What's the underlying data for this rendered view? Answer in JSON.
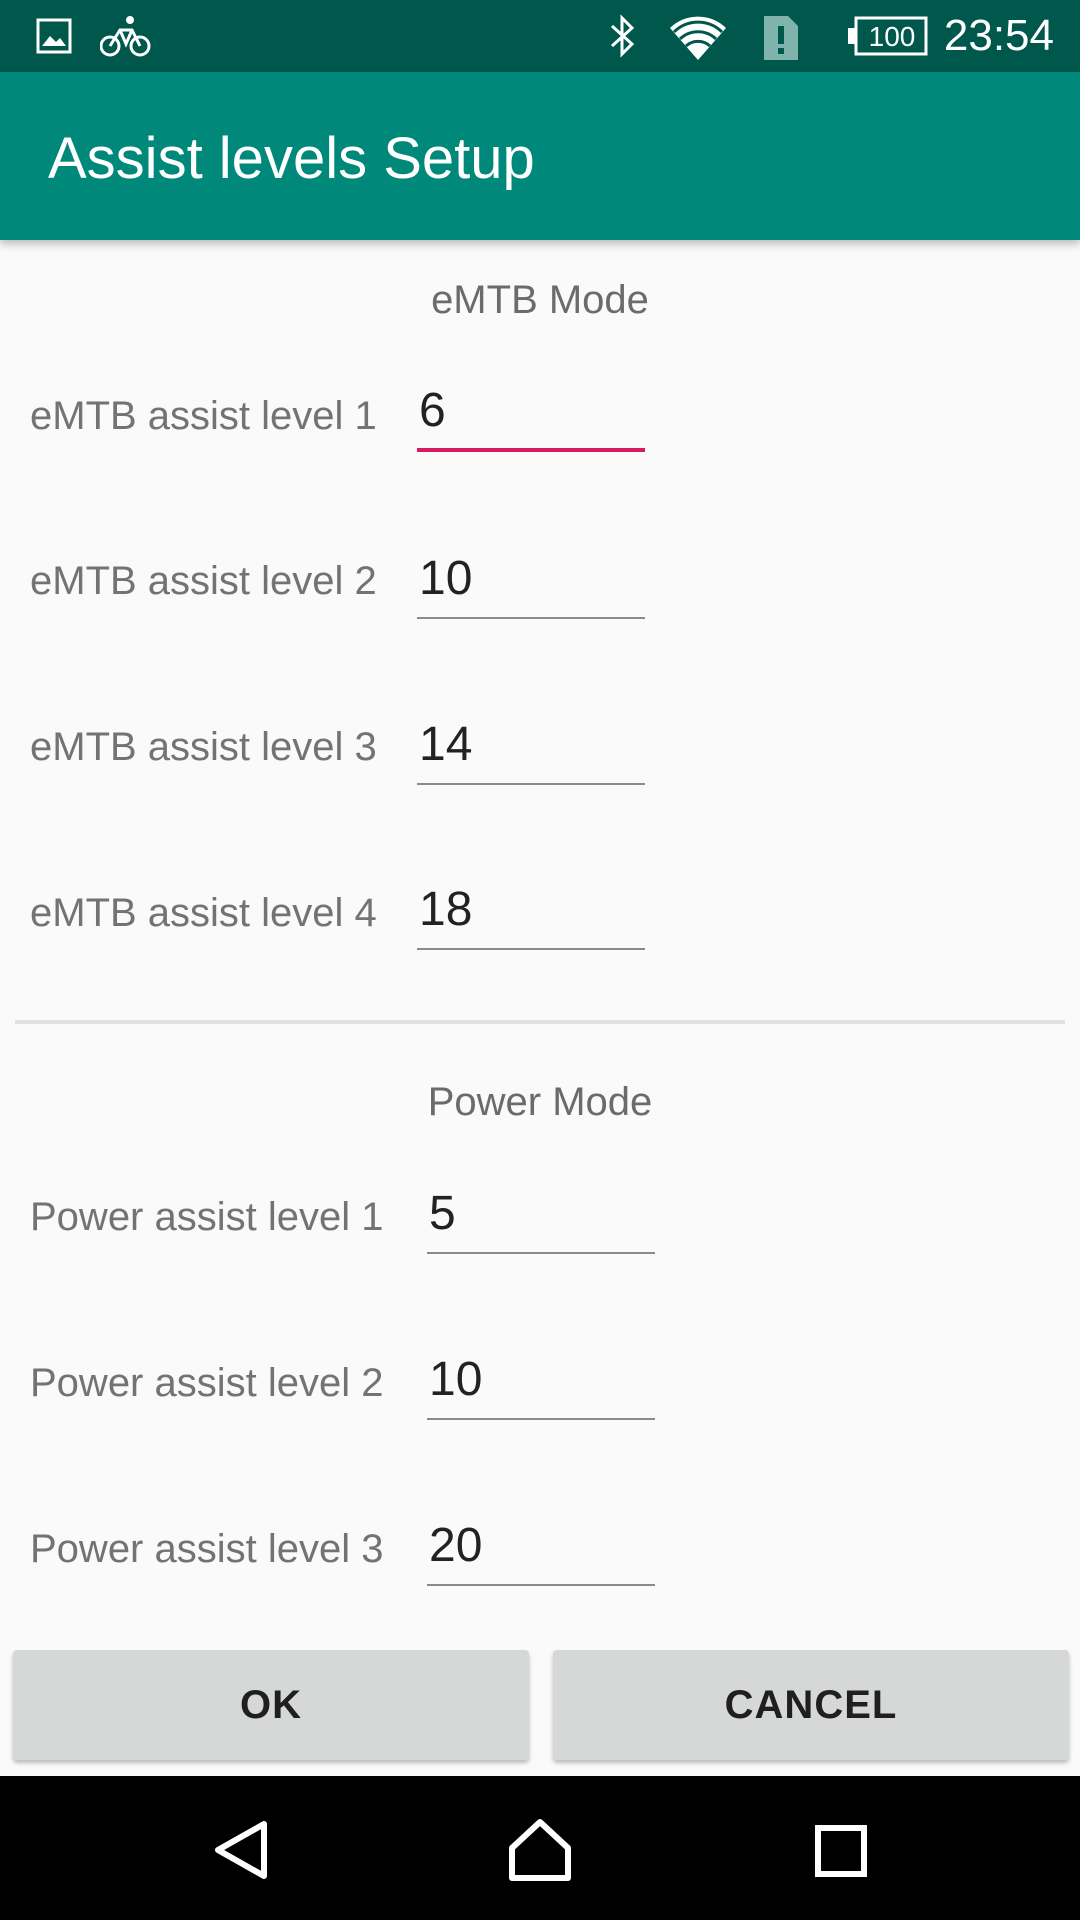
{
  "status_bar": {
    "time": "23:54",
    "battery_level": "100",
    "icons": [
      "image-icon",
      "bicycle-icon",
      "bluetooth-icon",
      "wifi-icon",
      "sim-alert-icon",
      "battery-icon"
    ]
  },
  "app_bar": {
    "title": "Assist levels Setup"
  },
  "emtb": {
    "heading": "eMTB Mode",
    "fields": [
      {
        "label": "eMTB assist level 1",
        "value": "6",
        "focused": true
      },
      {
        "label": "eMTB assist level 2",
        "value": "10"
      },
      {
        "label": "eMTB assist level 3",
        "value": "14"
      },
      {
        "label": "eMTB assist level 4",
        "value": "18"
      }
    ]
  },
  "power": {
    "heading": "Power Mode",
    "fields": [
      {
        "label": "Power assist level 1",
        "value": "5"
      },
      {
        "label": "Power assist level 2",
        "value": "10"
      },
      {
        "label": "Power assist level 3",
        "value": "20"
      }
    ]
  },
  "actions": {
    "ok_label": "OK",
    "cancel_label": "CANCEL"
  },
  "colors": {
    "status_bar": "#00574b",
    "app_bar": "#00897b",
    "accent": "#d81b60",
    "background": "#fafafa"
  },
  "nav_bar": {
    "icons": [
      "back-icon",
      "home-icon",
      "recents-icon"
    ]
  }
}
